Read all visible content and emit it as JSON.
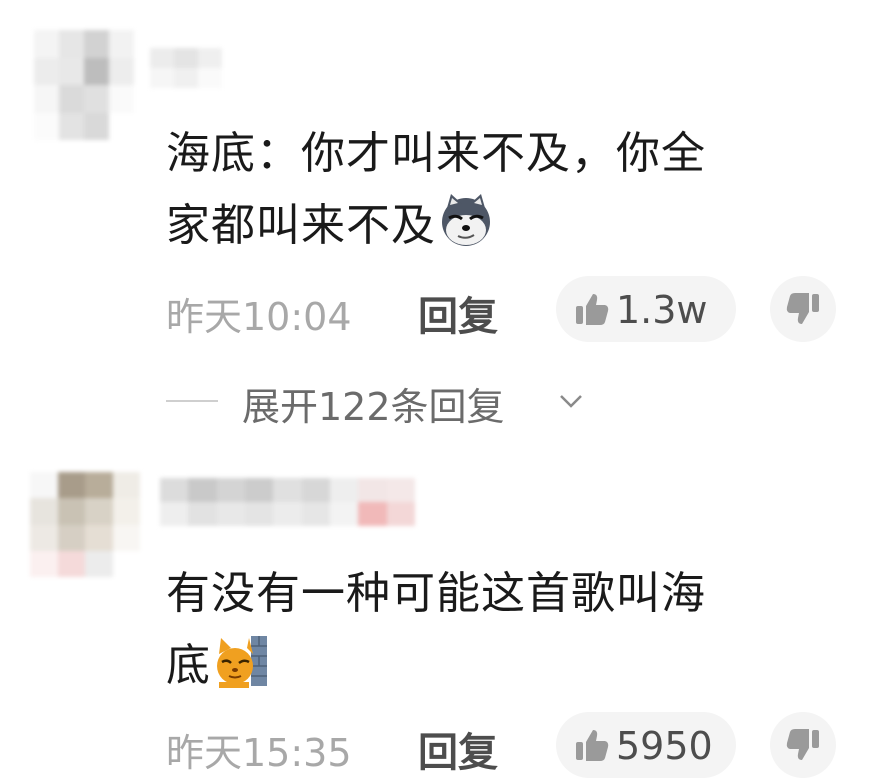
{
  "comments": [
    {
      "text_line1": "海底：你才叫来不及，你全",
      "text_line2": "家都叫来不及",
      "emoji": "husky-dog-emoji",
      "time": "昨天10:04",
      "reply_label": "回复",
      "like_count": "1.3w",
      "expand_label": "展开122条回复"
    },
    {
      "text_line1": "有没有一种可能这首歌叫海",
      "text_line2": "底",
      "emoji": "cat-peeking-emoji",
      "time": "昨天15:35",
      "reply_label": "回复",
      "like_count": "5950"
    }
  ],
  "icons": {
    "like": "thumbs-up-icon",
    "dislike": "thumbs-down-icon",
    "expand": "chevron-down-icon"
  },
  "colors": {
    "text": "#1a1a1a",
    "meta": "#a8a8a8",
    "pill": "#f4f4f4"
  }
}
